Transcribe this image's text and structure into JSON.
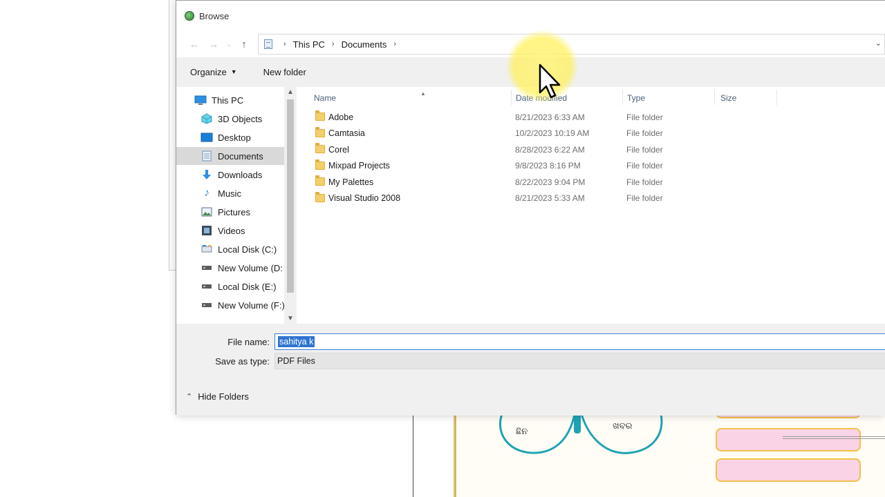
{
  "dialog": {
    "title": "Browse",
    "nav": {
      "back": "←",
      "forward": "→",
      "up": "↑"
    },
    "breadcrumb": [
      "This PC",
      "Documents"
    ],
    "toolbar": {
      "organize": "Organize",
      "new_folder": "New folder"
    }
  },
  "sidebar": {
    "items": [
      {
        "label": "This PC",
        "icon": "monitor-icon"
      },
      {
        "label": "3D Objects",
        "icon": "cube-icon"
      },
      {
        "label": "Desktop",
        "icon": "desktop-icon"
      },
      {
        "label": "Documents",
        "icon": "documents-icon",
        "selected": true
      },
      {
        "label": "Downloads",
        "icon": "download-arrow-icon"
      },
      {
        "label": "Music",
        "icon": "music-note-icon"
      },
      {
        "label": "Pictures",
        "icon": "pictures-icon"
      },
      {
        "label": "Videos",
        "icon": "film-icon"
      },
      {
        "label": "Local Disk (C:)",
        "icon": "drive-icon"
      },
      {
        "label": "New Volume (D:",
        "icon": "drive-icon"
      },
      {
        "label": "Local Disk (E:)",
        "icon": "drive-icon"
      },
      {
        "label": "New Volume (F:)",
        "icon": "drive-icon"
      }
    ]
  },
  "columns": {
    "name": "Name",
    "date": "Date modified",
    "type": "Type",
    "size": "Size"
  },
  "files": [
    {
      "name": "Adobe",
      "date": "8/21/2023 6:33 AM",
      "type": "File folder"
    },
    {
      "name": "Camtasia",
      "date": "10/2/2023 10:19 AM",
      "type": "File folder"
    },
    {
      "name": "Corel",
      "date": "8/28/2023 6:22 AM",
      "type": "File folder"
    },
    {
      "name": "Mixpad Projects",
      "date": "9/8/2023 8:16 PM",
      "type": "File folder"
    },
    {
      "name": "My Palettes",
      "date": "8/22/2023 9:04 PM",
      "type": "File folder"
    },
    {
      "name": "Visual Studio 2008",
      "date": "8/21/2023 5:33 AM",
      "type": "File folder"
    }
  ],
  "form": {
    "file_name_label": "File name:",
    "file_name_value": "sahitya k",
    "save_type_label": "Save as type:",
    "save_type_value": "PDF Files"
  },
  "footer": {
    "hide_folders": "Hide Folders"
  },
  "background_doc": {
    "label_left": "ଛିନ",
    "label_right": "ଖବର"
  }
}
